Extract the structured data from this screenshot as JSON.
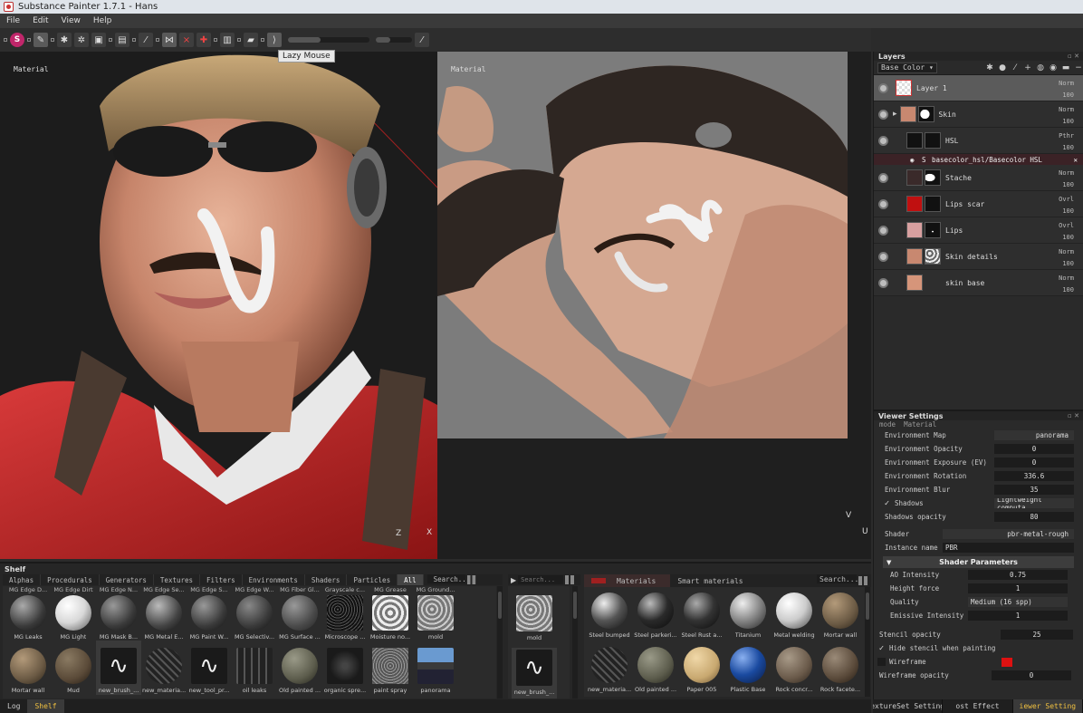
{
  "title": "Substance Painter 1.7.1 - Hans",
  "menu": [
    "File",
    "Edit",
    "View",
    "Help"
  ],
  "toolbar": {
    "tooltip": "Lazy Mouse",
    "logo_letter": "S"
  },
  "viewport3d": {
    "label": "Material",
    "axis_x": "X",
    "axis_z": "Z"
  },
  "viewport2d": {
    "label": "Material",
    "axis_u": "U",
    "axis_v": "V"
  },
  "colors": {
    "accent_yellow": "#f0c040",
    "selected_layer": "#5b5b5b",
    "wireframe_color": "#dd1111",
    "effect_row": "#3b2226",
    "lips_scar": "#c01010",
    "lips": "#d8a0a0",
    "skin": "#c88870"
  },
  "layers": {
    "title": "Layers",
    "channel": "Base Color",
    "items": [
      {
        "name": "Layer 1",
        "blend": "Norm",
        "opacity": "100",
        "selected": true,
        "thumb": "#e8e8e8"
      },
      {
        "name": "Skin",
        "blend": "Norm",
        "opacity": "100",
        "folder": true,
        "thumb": "#c88870"
      },
      {
        "name": "HSL",
        "blend": "Pthr",
        "opacity": "100",
        "thumb": "#111111"
      },
      {
        "name": "Stache",
        "blend": "Norm",
        "opacity": "100",
        "thumb": "#3a2a2a"
      },
      {
        "name": "Lips scar",
        "blend": "Ovrl",
        "opacity": "100",
        "thumb": "#c01010"
      },
      {
        "name": "Lips",
        "blend": "Ovrl",
        "opacity": "100",
        "thumb": "#d8a0a0"
      },
      {
        "name": "Skin details",
        "blend": "Norm",
        "opacity": "100",
        "thumb": "#c88870"
      },
      {
        "name": "skin base",
        "blend": "Norm",
        "opacity": "100",
        "thumb": "#d6957a"
      }
    ],
    "effect": "basecolor_hsl/Basecolor HSL"
  },
  "viewer_settings": {
    "title": "Viewer Settings",
    "mode_label": "mode",
    "mode_value": "Material",
    "rows": [
      {
        "label": "Environment Map",
        "value": "panorama"
      },
      {
        "label": "Environment Opacity",
        "value": "0"
      },
      {
        "label": "Environment Exposure (EV)",
        "value": "0"
      },
      {
        "label": "Environment Rotation",
        "value": "336.6"
      },
      {
        "label": "Environment Blur",
        "value": "35"
      }
    ],
    "shadows_label": "Shadows",
    "shadows_value": "Lightweight computa",
    "shadows_opacity_label": "Shadows opacity",
    "shadows_opacity_value": "80",
    "shader_label": "Shader",
    "shader_value": "pbr-metal-rough",
    "instance_label": "Instance name",
    "instance_value": "PBR",
    "shader_params_title": "Shader Parameters",
    "shader_params": [
      {
        "label": "AO Intensity",
        "value": "0.75"
      },
      {
        "label": "Height force",
        "value": "1"
      },
      {
        "label": "Quality",
        "value": "Medium (16 spp)"
      },
      {
        "label": "Emissive Intensity",
        "value": "1"
      }
    ],
    "stencil_opacity_label": "Stencil opacity",
    "stencil_opacity_value": "25",
    "hide_stencil_label": "Hide stencil when painting",
    "wireframe_label": "Wireframe",
    "wireframe_opacity_label": "Wireframe opacity",
    "wireframe_opacity_value": "0"
  },
  "right_bottom_tabs": [
    "extureSet Setting",
    "ost Effect",
    "iewer Setting"
  ],
  "shelf": {
    "title": "Shelf",
    "tabs": [
      "Alphas",
      "Procedurals",
      "Generators",
      "Textures",
      "Filters",
      "Environments",
      "Shaders",
      "Particles",
      "All"
    ],
    "search_placeholder": "Search...",
    "row1": [
      {
        "top": "MG Edge D...",
        "label": "MG Leaks",
        "color": "#3a3a3a"
      },
      {
        "top": "MG Edge Dirt",
        "label": "MG Light",
        "color": "#d8d8d8"
      },
      {
        "top": "MG Edge N...",
        "label": "MG Mask B...",
        "color": "#3a3a3a"
      },
      {
        "top": "MG Edge Se...",
        "label": "MG Metal E...",
        "color": "#444444"
      },
      {
        "top": "MG Edge S...",
        "label": "MG Paint W...",
        "color": "#3a3a3a"
      },
      {
        "top": "MG Edge W...",
        "label": "MG Selectiv...",
        "color": "#3a3a3a"
      },
      {
        "top": "MG Fiber Gl...",
        "label": "MG Surface ...",
        "color": "#4a4a4a"
      },
      {
        "top": "Grayscale c...",
        "label": "Microscope ...",
        "color": "#2a2a2a",
        "square": true
      },
      {
        "top": "MG Grease",
        "label": "Moisture no...",
        "color": "#bbbbbb",
        "square": true
      },
      {
        "top": "MG Ground...",
        "label": "mold",
        "color": "#999999",
        "square": true
      }
    ],
    "row2": [
      {
        "label": "Mortar wall",
        "color": "#6b5a44"
      },
      {
        "label": "Mud",
        "color": "#5a4a38"
      },
      {
        "label": "new_brush_...",
        "color": "#eeeeee",
        "square": true
      },
      {
        "label": "new_materia...",
        "color": "#222222"
      },
      {
        "label": "new_tool_pr...",
        "color": "#eeeeee",
        "square": true
      },
      {
        "label": "oil leaks",
        "color": "#333333",
        "square": true
      },
      {
        "label": "Old painted ...",
        "color": "#5c5c4c"
      },
      {
        "label": "organic spre...",
        "color": "#1a1a1a",
        "square": true
      },
      {
        "label": "paint spray",
        "color": "#777777",
        "square": true
      },
      {
        "label": "panorama",
        "color": "#3a6aa0",
        "square": true
      }
    ]
  },
  "brush_pane": {
    "search_placeholder": "Search...",
    "items": [
      {
        "label": "mold",
        "color": "#999999"
      },
      {
        "label": "new_brush_...",
        "color": "#eeeeee"
      }
    ]
  },
  "materials_pane": {
    "tabs": [
      "Materials",
      "Smart materials"
    ],
    "search_placeholder": "Search...",
    "row1": [
      {
        "label": "Steel bumped",
        "color": "#555555"
      },
      {
        "label": "Steel parkeri...",
        "color": "#2a2a2a"
      },
      {
        "label": "Steel Rust a...",
        "color": "#333333"
      },
      {
        "label": "Titanium",
        "color": "#888888"
      },
      {
        "label": "Metal welding",
        "color": "#cccccc"
      },
      {
        "label": "Mortar wall",
        "color": "#6b5a44"
      }
    ],
    "row2": [
      {
        "label": "new_materia...",
        "color": "#222222"
      },
      {
        "label": "Old painted ...",
        "color": "#5c5c4c"
      },
      {
        "label": "Paper 005",
        "color": "#c8a870"
      },
      {
        "label": "Plastic Base",
        "color": "#1a4aa0"
      },
      {
        "label": "Rock concr...",
        "color": "#6a5a4a"
      },
      {
        "label": "Rock facete...",
        "color": "#5a4a3a"
      }
    ]
  },
  "bottom_tabs": [
    "Log",
    "Shelf"
  ]
}
